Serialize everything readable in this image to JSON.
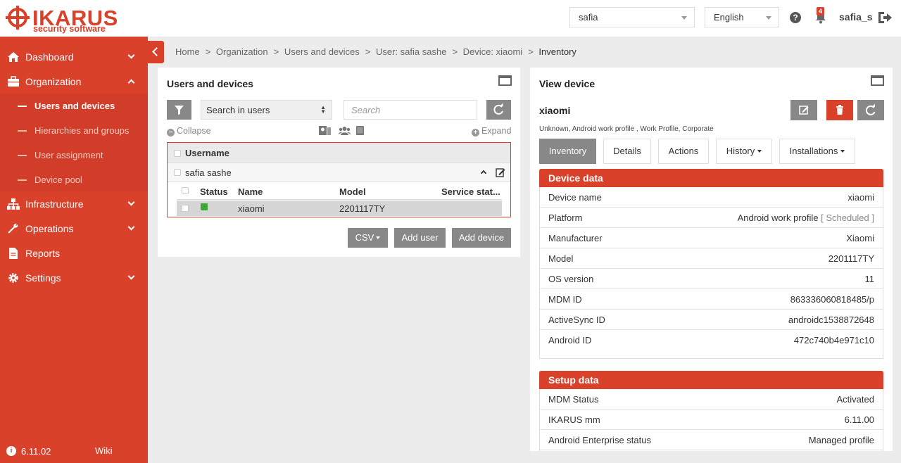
{
  "brand": {
    "name": "IKARUS",
    "tagline": "security software",
    "accent": "#d9412b"
  },
  "header": {
    "tenant_select": "safia",
    "language_select": "English",
    "notification_count": "4",
    "username": "safia_s"
  },
  "sidebar": {
    "items": [
      {
        "label": "Dashboard",
        "icon": "home-icon"
      },
      {
        "label": "Organization",
        "icon": "briefcase-icon"
      },
      {
        "label": "Infrastructure",
        "icon": "sitemap-icon"
      },
      {
        "label": "Operations",
        "icon": "wrench-icon"
      },
      {
        "label": "Reports",
        "icon": "document-icon"
      },
      {
        "label": "Settings",
        "icon": "gear-icon"
      }
    ],
    "sub_items": [
      {
        "label": "Users and devices",
        "active": true
      },
      {
        "label": "Hierarchies and groups"
      },
      {
        "label": "User assignment"
      },
      {
        "label": "Device pool"
      }
    ],
    "version": "6.11.02",
    "wiki": "Wiki"
  },
  "breadcrumb": [
    "Home",
    "Organization",
    "Users and devices",
    "User: safia sashe",
    "Device: xiaomi",
    "Inventory"
  ],
  "left_panel": {
    "title": "Users and devices",
    "search_select": "Search in users",
    "search_placeholder": "Search",
    "collapse": "Collapse",
    "expand": "Expand",
    "table_header": "Username",
    "user_row": "safia sashe",
    "device_columns": [
      "Status",
      "Name",
      "Model",
      "Service stat..."
    ],
    "device_row": {
      "name": "xiaomi",
      "model": "2201117TY",
      "service": ""
    },
    "buttons": {
      "csv": "CSV",
      "add_user": "Add user",
      "add_device": "Add device"
    }
  },
  "right_panel": {
    "title": "View device",
    "device_name": "xiaomi",
    "device_sub": "Unknown, Android work profile , Work Profile, Corporate",
    "tabs": [
      "Inventory",
      "Details",
      "Actions",
      "History",
      "Installations"
    ],
    "device_data": {
      "heading": "Device data",
      "rows": [
        {
          "k": "Device name",
          "v": "xiaomi"
        },
        {
          "k": "Platform",
          "v": "Android work profile",
          "extra": "[ Scheduled ]"
        },
        {
          "k": "Manufacturer",
          "v": "Xiaomi"
        },
        {
          "k": "Model",
          "v": "2201117TY"
        },
        {
          "k": "OS version",
          "v": "11"
        },
        {
          "k": "MDM ID",
          "v": "863336060818485/p"
        },
        {
          "k": "ActiveSync ID",
          "v": "androidc1538872648"
        },
        {
          "k": "Android ID",
          "v": "472c740b4e971c10"
        }
      ]
    },
    "setup_data": {
      "heading": "Setup data",
      "rows": [
        {
          "k": "MDM Status",
          "v": "Activated"
        },
        {
          "k": "IKARUS mm",
          "v": "6.11.00"
        },
        {
          "k": "Android Enterprise status",
          "v": "Managed profile"
        }
      ]
    }
  }
}
